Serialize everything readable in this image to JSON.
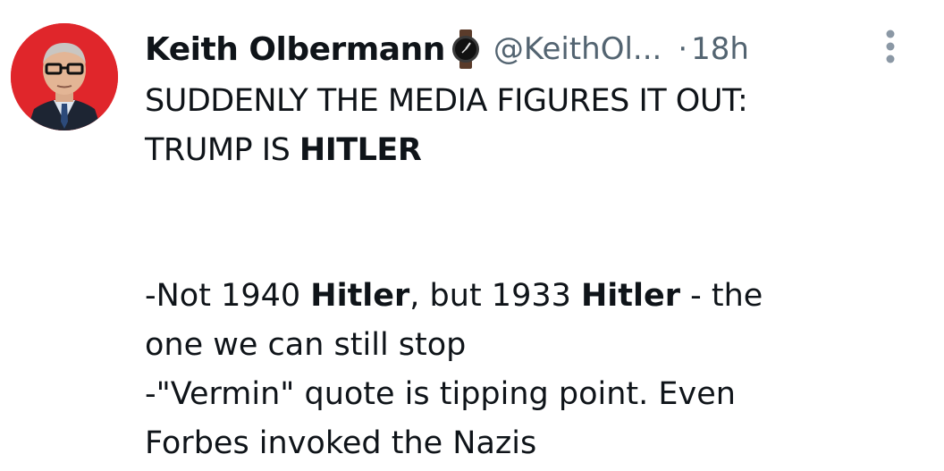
{
  "author": {
    "name": "Keith Olbermann",
    "handle": "@KeithOl...",
    "separator": "·",
    "time": "18h",
    "badge_icon": "watch-icon",
    "avatar_bg": "#e0262b"
  },
  "more_icon": "vertical-ellipsis-icon",
  "tweet": {
    "headline_1": "SUDDENLY THE MEDIA FIGURES IT OUT:",
    "headline_2_prefix": "TRUMP IS ",
    "headline_2_bold": "HITLER",
    "p1_a": "-Not 1940 ",
    "p1_b": "Hitler",
    "p1_c": ", but 1933 ",
    "p1_d": "Hitler",
    "p1_e": " - the",
    "p1_line2": "one we can still stop",
    "p2_line1": "-\"Vermin\" quote is tipping point. Even",
    "p2_line2": "Forbes invoked the Nazis"
  },
  "colors": {
    "text": "#0f1419",
    "secondary": "#536471",
    "avatar_red": "#e0262b"
  }
}
